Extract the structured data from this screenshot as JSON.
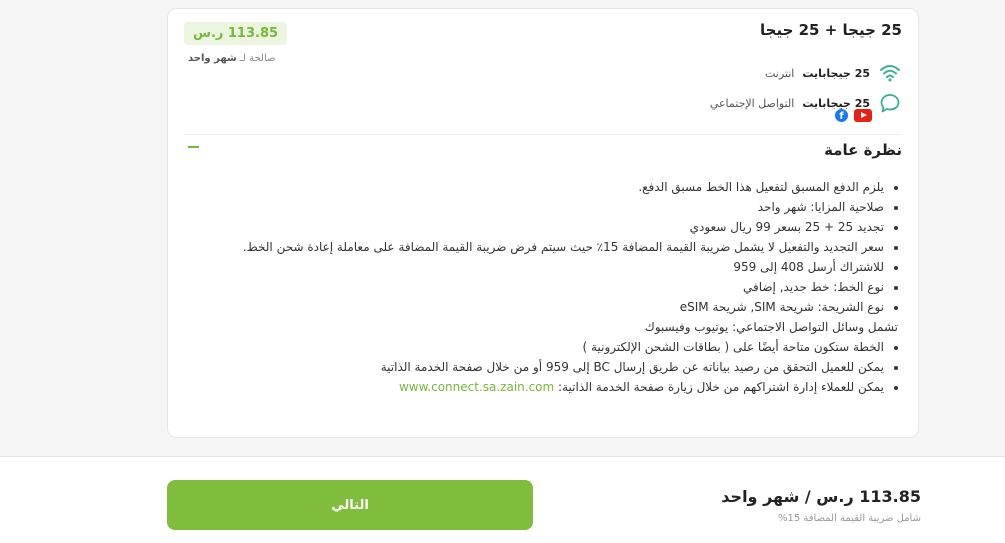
{
  "plan": {
    "title": "25 جيجا + 25 جيجا",
    "price": "113.85 ر.س",
    "validity_prefix": "صالحة لـ",
    "validity_value": "شهر واحد",
    "internet": {
      "amount": "25 جيجابايت",
      "label": "انترنت",
      "icon": "wifi-icon"
    },
    "social": {
      "amount": "25 جيجابايت",
      "label": "التواصل الإجتماعي",
      "icon": "chat-bubble-icon",
      "apps": [
        "youtube-icon",
        "facebook-icon"
      ]
    }
  },
  "overview": {
    "title": "نظرة عامة",
    "items": [
      "يلزم الدفع المسبق لتفعيل هذا الخط مسبق الدفع.",
      "صلاحية المزايا: شهر واحد",
      "تجديد 25 + 25 بسعر 99 ريال سعودي",
      "سعر التجديد والتفعيل لا يشمل ضريبة القيمة المضافة 15٪ حيث سيتم فرض ضريبة القيمة المضافة على معاملة إعادة شحن الخط.",
      "للاشتراك أرسل 408 إلى 959",
      "نوع الخط: خط جديد, إضافي",
      "نوع الشريحة: شريحة SIM, شريحة eSIM"
    ],
    "social_heading": "تشمل وسائل التواصل الاجتماعي: يوتيوب وفيسبوك",
    "items2": [
      "الخطة ستكون متاحة أيضًا على ( بطاقات الشحن الإلكترونية )",
      "يمكن للعميل التحقق من رصيد بياناته عن طريق إرسال BC إلى 959 أو من خلال صفحة الخدمة الذاتية",
      "يمكن للعملاء إدارة اشتراكهم من خلال زيارة صفحة الخدمة الذاتية:"
    ],
    "link": "www.connect.sa.zain.com"
  },
  "footer": {
    "total": "113.85 ر.س / شهر واحد",
    "vat_note": "شامل ضريبة القيمة المضافة 15%",
    "next_label": "التالي"
  },
  "colors": {
    "accent": "#80bd3d",
    "badge_bg": "#ecf5df"
  }
}
